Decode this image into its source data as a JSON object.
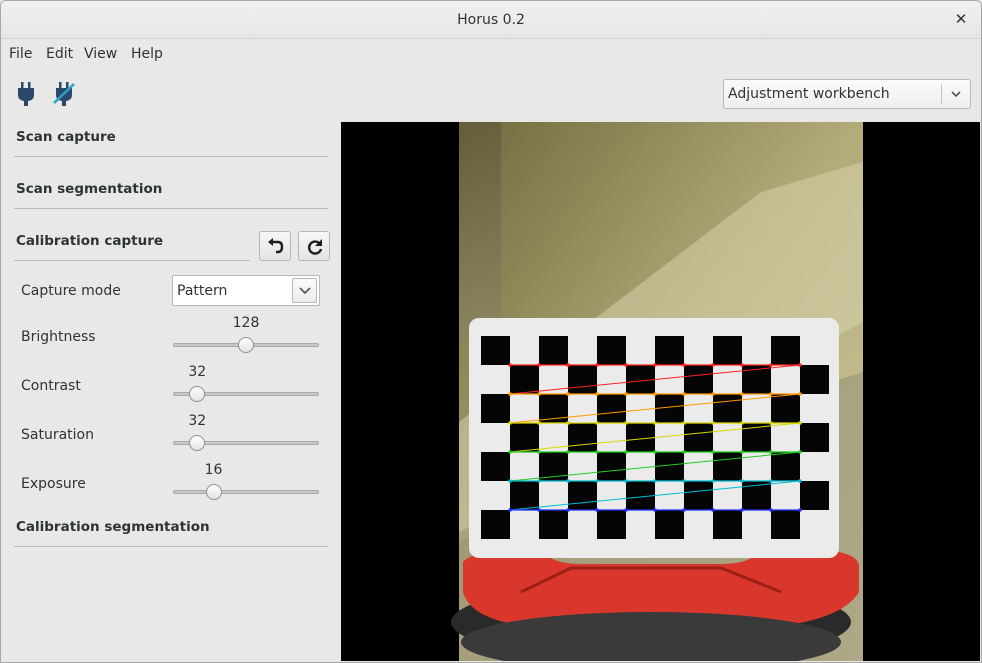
{
  "window": {
    "title": "Horus 0.2",
    "close_glyph": "✕"
  },
  "menu": [
    "File",
    "Edit",
    "View",
    "Help"
  ],
  "toolbar": {
    "connect_icon": "plug-icon",
    "disconnect_icon": "plug-disconnect-icon",
    "workbench": "Adjustment workbench"
  },
  "panel": {
    "sections": {
      "scan_capture": "Scan capture",
      "scan_segmentation": "Scan segmentation",
      "calibration_capture": "Calibration capture",
      "calibration_segmentation": "Calibration segmentation"
    },
    "undo_icon": "undo-icon",
    "restore_icon": "refresh-icon",
    "capture_mode": {
      "label": "Capture mode",
      "value": "Pattern"
    },
    "sliders": [
      {
        "label": "Brightness",
        "value": "128",
        "level": 0.5
      },
      {
        "label": "Contrast",
        "value": "32",
        "level": 0.125
      },
      {
        "label": "Saturation",
        "value": "32",
        "level": 0.125
      },
      {
        "label": "Exposure",
        "value": "16",
        "level": 0.25
      }
    ]
  },
  "camera_view": {
    "content": "checkerboard-pattern",
    "colors": {
      "background": "#000000",
      "platform": "#d9362c",
      "board": "#ebebeb",
      "square": "#050505"
    }
  }
}
